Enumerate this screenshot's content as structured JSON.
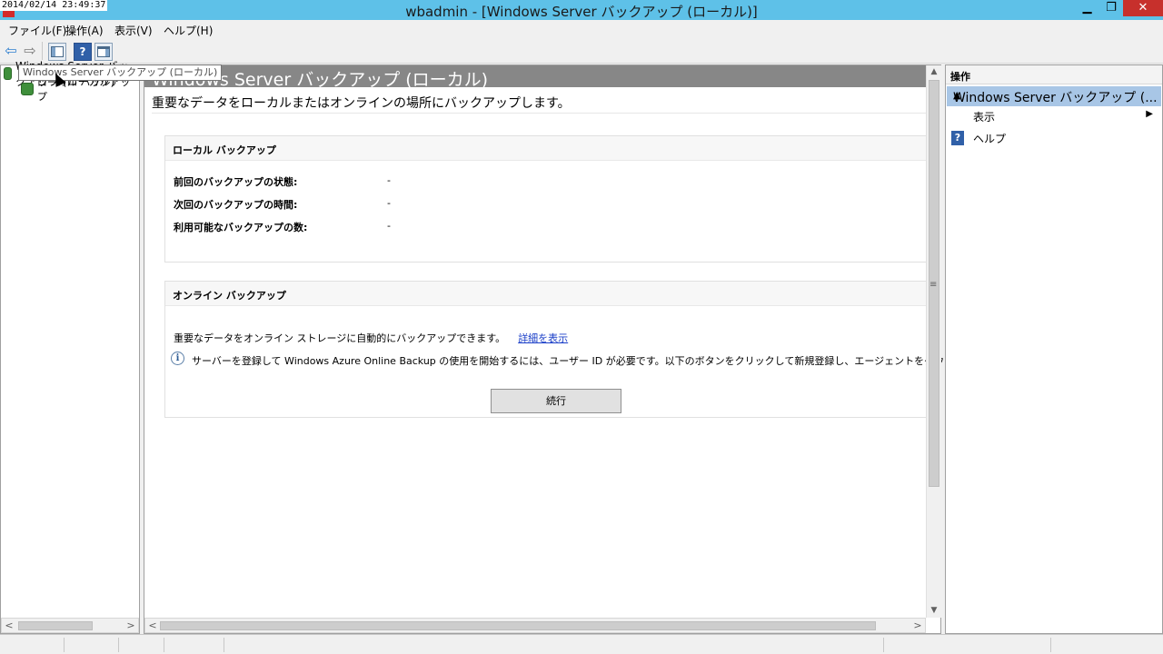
{
  "window": {
    "title": "wbadmin - [Windows Server バックアップ (ローカル)]",
    "clock": "2014/02/14 23:49:37",
    "min_glyph": "▁",
    "max_glyph": "❐",
    "close_glyph": "✕"
  },
  "menu": {
    "file": "ファイル(F)",
    "action": "操作(A)",
    "view": "表示(V)",
    "help": "ヘルプ(H)"
  },
  "toolbar": {
    "back_glyph": "⇦",
    "forward_glyph": "⇨"
  },
  "tree": {
    "root_label": "Windows Server バックアップ (ローカル)",
    "tooltip": "Windows Server バックアップ (ローカル)",
    "child_label": "ローカル バックアップ"
  },
  "center": {
    "header_title": "Windows Server バックアップ (ローカル)",
    "description": "重要なデータをローカルまたはオンラインの場所にバックアップします。",
    "local": {
      "title": "ローカル バックアップ",
      "rows": [
        {
          "label": "前回のバックアップの状態:",
          "value": "-"
        },
        {
          "label": "次回のバックアップの時間:",
          "value": "-"
        },
        {
          "label": "利用可能なバックアップの数:",
          "value": "-"
        }
      ]
    },
    "online": {
      "title": "オンライン バックアップ",
      "text": "重要なデータをオンライン ストレージに自動的にバックアップできます。",
      "link": "詳細を表示",
      "info": "サーバーを登録して Windows Azure Online Backup の使用を開始するには、ユーザー ID が必要です。以下のボタンをクリックして新規登録し、エージェントをダウンロードしてください。",
      "continue": "続行"
    }
  },
  "actions": {
    "header": "操作",
    "group": "Windows Server バックアップ (...",
    "view": "表示",
    "help": "ヘルプ"
  }
}
